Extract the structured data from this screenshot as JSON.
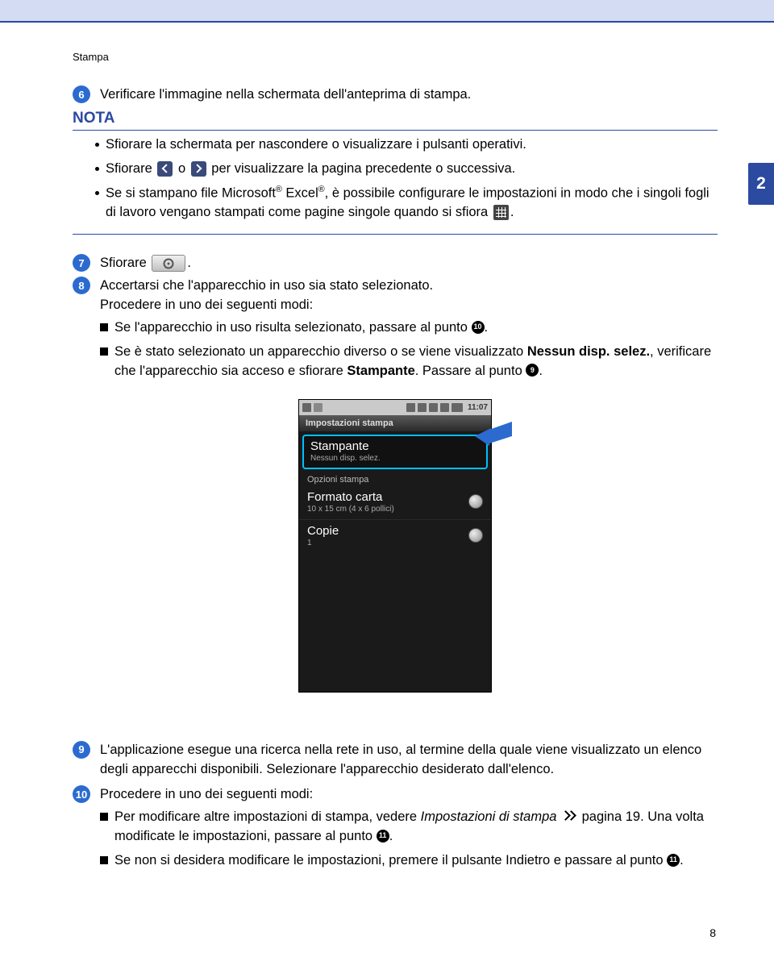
{
  "header": {
    "label": "Stampa"
  },
  "side_tab": "2",
  "page_number": "8",
  "steps": {
    "s6": "Verificare l'immagine nella schermata dell'anteprima di stampa.",
    "s7": "Sfiorare ",
    "s8": {
      "line1": "Accertarsi che l'apparecchio in uso sia stato selezionato.",
      "line2": "Procedere in uno dei seguenti modi:",
      "sub1_a": "Se l'apparecchio in uso risulta selezionato, passare al punto ",
      "sub2_a": "Se è stato selezionato un apparecchio diverso o se viene visualizzato ",
      "sub2_b": "Nessun disp. selez.",
      "sub2_c": ", verificare che l'apparecchio sia acceso e sfiorare ",
      "sub2_d": "Stampante",
      "sub2_e": ". Passare al punto "
    },
    "s9": "L'applicazione esegue una ricerca nella rete in uso, al termine della quale viene visualizzato un elenco degli apparecchi disponibili. Selezionare l'apparecchio desiderato dall'elenco.",
    "s10": {
      "line1": "Procedere in uno dei seguenti modi:",
      "sub1_a": "Per modificare altre impostazioni di stampa, vedere ",
      "sub1_b": "Impostazioni di stampa",
      "sub1_c": " pagina 19. Una volta modificate le impostazioni, passare al punto ",
      "sub2_a": "Se non si desidera modificare le impostazioni, premere il pulsante Indietro e passare al punto "
    }
  },
  "nota": {
    "title": "NOTA",
    "b1": "Sfiorare la schermata per nascondere o visualizzare i pulsanti operativi.",
    "b2_a": "Sfiorare ",
    "b2_b": " o ",
    "b2_c": " per visualizzare la pagina precedente o successiva.",
    "b3_a": "Se si stampano file Microsoft",
    "b3_b": " Excel",
    "b3_c": ", è possibile configurare le impostazioni in modo che i singoli fogli di lavoro vengano stampati come pagine singole quando si sfiora "
  },
  "phone": {
    "time": "11:07",
    "title": "Impostazioni stampa",
    "printer_label": "Stampante",
    "printer_sub": "Nessun disp. selez.",
    "section": "Opzioni stampa",
    "opt1_t": "Formato carta",
    "opt1_s": "10 x 15 cm (4 x 6 pollici)",
    "opt2_t": "Copie",
    "opt2_s": "1"
  },
  "refs": {
    "r9": "9",
    "r10": "10",
    "r11": "11"
  }
}
